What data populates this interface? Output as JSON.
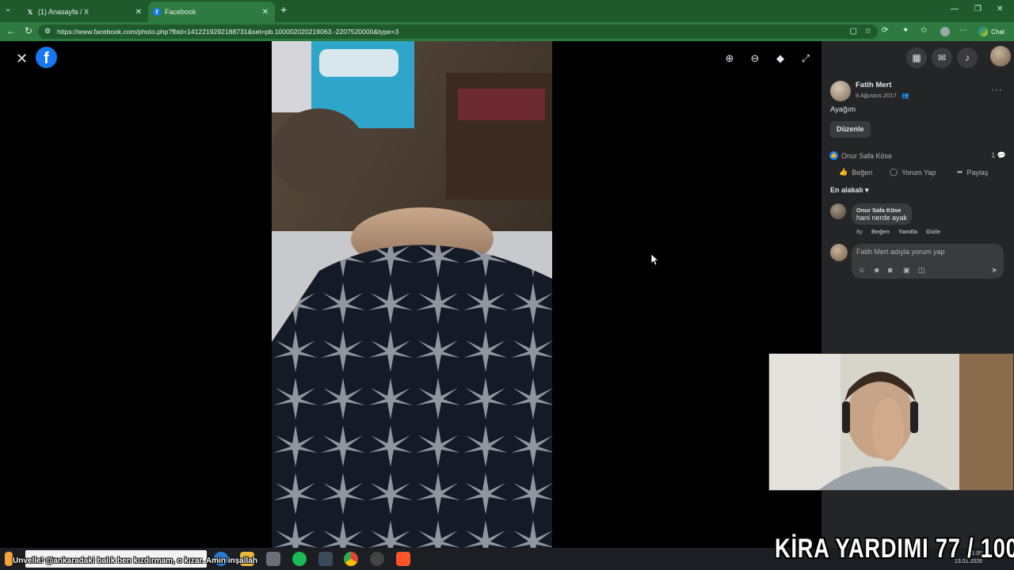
{
  "browser": {
    "tabs": [
      {
        "label": "(1) Anasayfa / X",
        "icon": "x-logo-icon"
      },
      {
        "label": "Facebook",
        "icon": "facebook-logo-icon"
      }
    ],
    "url": "https://www.facebook.com/photo.php?fbid=1412219292188731&set=pb.100002020219063.-2207520000&type=3",
    "chat_label": "Chat"
  },
  "viewer": {
    "controls": [
      "zoom-in-icon",
      "zoom-out-icon",
      "tag-icon",
      "fullscreen-icon"
    ]
  },
  "post": {
    "author": "Fatih Mert",
    "date": "9 Ağustos 2017 ·",
    "caption": "Ayağım",
    "edit_label": "Düzenle",
    "reactor": "Onur Safa Köse",
    "comment_count": "1",
    "actions": {
      "like": "Beğen",
      "comment": "Yorum Yap",
      "share": "Paylaş"
    },
    "sort_label": "En alakalı"
  },
  "comment": {
    "author": "Onur Safa Köse",
    "text": "hani nerde ayak",
    "actions": [
      "8y",
      "Beğen",
      "Yanıtla",
      "Gizle"
    ]
  },
  "composer": {
    "placeholder": "Fatih Mert adıyla yorum yap"
  },
  "taskbar": {
    "search_text": "Such...",
    "time": "1:09",
    "date": "13.01.2026"
  },
  "overlay": {
    "ticker": "Unvelle: @ankaradaki balık ben kızdırmam, o kızar. Amin inşallah",
    "counter": "KİRA YARDIMI  77 / 100"
  },
  "colors": {
    "accent": "#1877f2",
    "panel": "#242526",
    "chrome": "#2e7a40"
  }
}
